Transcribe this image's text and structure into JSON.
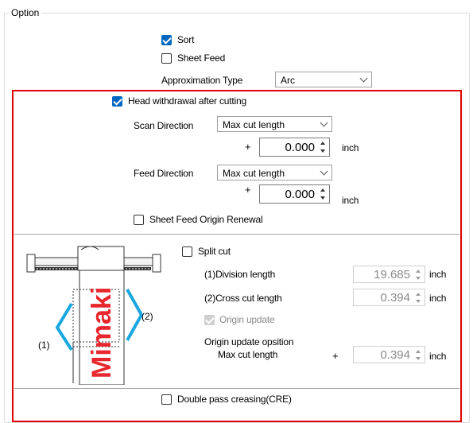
{
  "group_title": "Option",
  "sort": {
    "label": "Sort",
    "checked": true
  },
  "sheet_feed": {
    "label": "Sheet Feed",
    "checked": false
  },
  "approximation": {
    "label": "Approximation Type",
    "value": "Arc"
  },
  "head_withdrawal": {
    "label": "Head withdrawal after cutting",
    "checked": true
  },
  "scan_direction": {
    "label": "Scan Direction",
    "mode": "Max cut length",
    "sign": "+",
    "value": "0.000",
    "unit": "inch"
  },
  "feed_direction": {
    "label": "Feed Direction",
    "mode": "Max cut length",
    "sign": "+",
    "value": "0.000",
    "unit": "inch"
  },
  "sheet_feed_origin": {
    "label": "Sheet Feed Origin Renewal",
    "checked": false
  },
  "split_cut": {
    "label": "Split cut",
    "checked": false
  },
  "division_length": {
    "label": "(1)Division  length",
    "value": "19.685",
    "unit": "inch"
  },
  "cross_cut_length": {
    "label": "(2)Cross cut length",
    "value": "0.394",
    "unit": "inch"
  },
  "origin_update": {
    "label": "Origin update",
    "checked": true
  },
  "origin_update_position": {
    "label": "Origin update opsition",
    "sublabel": "Max cut length",
    "sign": "+",
    "value": "0.394",
    "unit": "inch"
  },
  "double_pass": {
    "label": "Double pass creasing(CRE)",
    "checked": false
  },
  "illustration": {
    "brand": "Mimaki",
    "marker1": "(1)",
    "marker2": "(2)"
  },
  "colors": {
    "accent": "#0067c0",
    "highlight": "#e00000",
    "bracket": "#1aa7e0",
    "logo": "#e8262d"
  }
}
